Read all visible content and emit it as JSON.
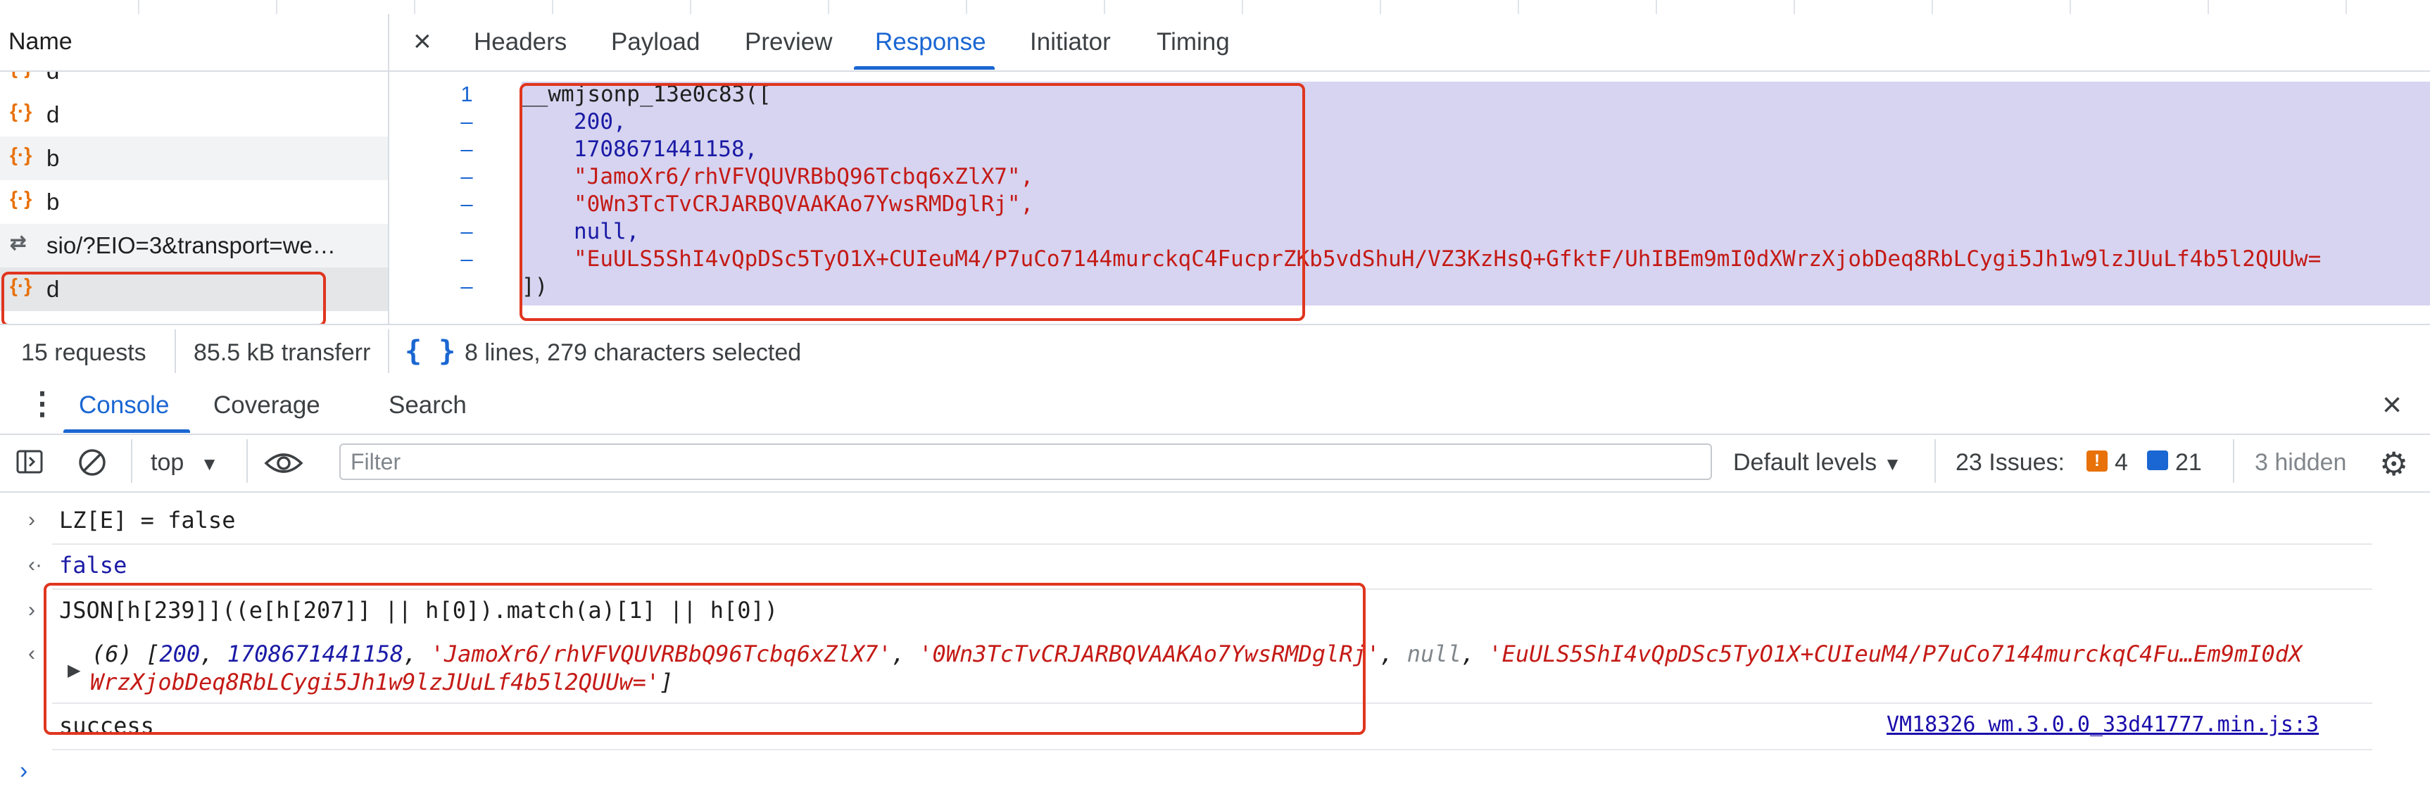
{
  "network": {
    "name_header": "Name",
    "requests": [
      {
        "label": "d",
        "icon": "json-icon"
      },
      {
        "label": "d",
        "icon": "json-icon"
      },
      {
        "label": "b",
        "icon": "json-icon"
      },
      {
        "label": "b",
        "icon": "json-icon"
      },
      {
        "label": "sio/?EIO=3&transport=we…",
        "icon": "websocket-icon"
      },
      {
        "label": "d",
        "icon": "json-icon"
      }
    ],
    "status": {
      "requests": "15 requests",
      "transferred": "85.5 kB transferr",
      "selection": "8 lines, 279 characters selected"
    }
  },
  "detail": {
    "tabs": [
      "Headers",
      "Payload",
      "Preview",
      "Response",
      "Initiator",
      "Timing"
    ],
    "active_tab": "Response",
    "gutter": [
      "1",
      "–",
      "–",
      "–",
      "–",
      "–",
      "–",
      "–"
    ],
    "code": {
      "line1": "__wmjsonp_13e0c83([",
      "v200": "200,",
      "ts": "1708671441158,",
      "s1": "\"JamoXr6/rhVFVQUVRBbQ96Tcbq6xZlX7\",",
      "s2": "\"0Wn3TcTvCRJARBQVAAKAo7YwsRMDglRj\",",
      "nul": "null,",
      "s3": "\"EuULS5ShI4vQpDSc5TyO1X+CUIeuM4/P7uCo7144murckqC4FucprZKb5vdShuH/VZ3KzHsQ+GfktF/UhIBEm9mI0dXWrzXjobDeq8RbLCygi5Jh1w9lzJUuLf4b5l2QUUw=",
      "end": "])"
    }
  },
  "drawer": {
    "tabs": [
      "Console",
      "Coverage",
      "Search"
    ],
    "active_tab": "Console"
  },
  "console": {
    "context": "top",
    "filter_placeholder": "Filter",
    "levels": "Default levels",
    "issues_label": "23 Issues:",
    "issues_warn": "4",
    "issues_info": "21",
    "hidden": "3 hidden",
    "entries": {
      "in1": "LZ[E] = false",
      "out1": "false",
      "in2": "JSON[h[239]]((e[h[207]] || h[0]).match(a)[1] || h[0])",
      "out2_line1_a": "(6) [",
      "out2_n200": "200",
      "out2_ts": "1708671441158",
      "out2_s1": "'JamoXr6/rhVFVQUVRBbQ96Tcbq6xZlX7'",
      "out2_s2": "'0Wn3TcTvCRJARBQVAAKAo7YwsRMDglRj'",
      "out2_null": "null",
      "out2_s3a": "'EuULS5ShI4vQpDSc5TyO1X+CUIeuM4/P7uCo7144murckqC4Fu…Em9mI0dX",
      "out2_s3b": "WrzXjobDeq8RbLCygi5Jh1w9lzJUuLf4b5l2QUUw='",
      "log": "success",
      "source": "VM18326 wm.3.0.0_33d41777.min.js:3"
    }
  },
  "colors": {
    "accent": "#1a66d2",
    "highlight_border": "#e0351e",
    "selection": "#d6d4f0",
    "string": "#c41a16",
    "number": "#1a1aa6"
  }
}
